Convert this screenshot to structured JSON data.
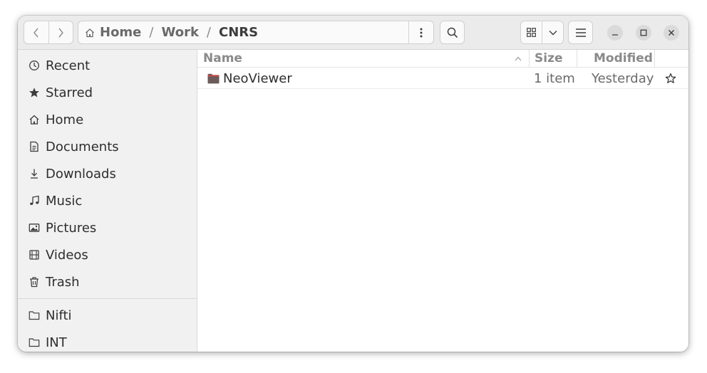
{
  "window": {
    "title": "CNRS"
  },
  "pathbar": {
    "crumbs": [
      "Home",
      "Work",
      "CNRS"
    ],
    "separator": "/"
  },
  "icons": {
    "back": "chevron-left-icon",
    "forward": "chevron-right-icon",
    "home": "home-icon",
    "path_menu": "vertical-dots-icon",
    "search": "search-icon",
    "grid_view": "grid-icon",
    "view_options": "chevron-down-icon",
    "main_menu": "hamburger-icon",
    "minimize": "minimize-icon",
    "maximize": "maximize-icon",
    "close": "close-icon"
  },
  "sidebar": {
    "items": [
      {
        "label": "Recent",
        "icon": "clock-icon"
      },
      {
        "label": "Starred",
        "icon": "star-icon"
      },
      {
        "label": "Home",
        "icon": "home-icon"
      },
      {
        "label": "Documents",
        "icon": "document-icon"
      },
      {
        "label": "Downloads",
        "icon": "download-icon"
      },
      {
        "label": "Music",
        "icon": "music-note-icon"
      },
      {
        "label": "Pictures",
        "icon": "picture-icon"
      },
      {
        "label": "Videos",
        "icon": "film-icon"
      },
      {
        "label": "Trash",
        "icon": "trash-icon"
      }
    ],
    "bookmarks": [
      {
        "label": "Nifti",
        "icon": "folder-icon"
      },
      {
        "label": "INT",
        "icon": "folder-icon"
      }
    ]
  },
  "file_list": {
    "columns": {
      "name": "Name",
      "size": "Size",
      "modified": "Modified"
    },
    "sort_indicator": "chevron-up-icon",
    "rows": [
      {
        "name": "NeoViewer",
        "size": "1 item",
        "modified": "Yesterday",
        "icon": "folder-icon",
        "starred": false
      }
    ]
  },
  "colors": {
    "folder": "#6b5b5b",
    "folder_tab": "#c94a4a",
    "headerbar": "#ebebeb",
    "sidebar": "#f1f1f1"
  }
}
